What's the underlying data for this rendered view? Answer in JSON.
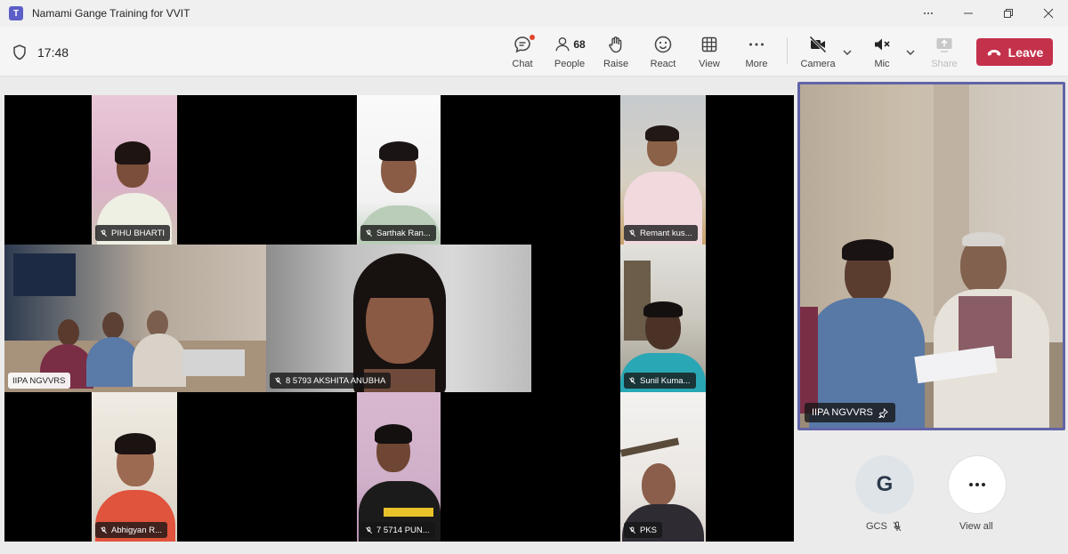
{
  "window": {
    "title": "Namami Gange Training for VVIT",
    "app_icon": "teams-icon"
  },
  "toolbar": {
    "timer": "17:48",
    "chat": "Chat",
    "people": "People",
    "people_count": "68",
    "raise": "Raise",
    "react": "React",
    "view": "View",
    "more": "More",
    "camera": "Camera",
    "mic": "Mic",
    "share": "Share",
    "leave": "Leave"
  },
  "grid": {
    "participants": [
      {
        "name": "PIHU BHARTI"
      },
      {
        "name": "Sarthak Ran..."
      },
      {
        "name": "Remant kus..."
      },
      {
        "name": "IIPA NGVVRS"
      },
      {
        "name": "8 5793 AKSHITA ANUBHA"
      },
      {
        "name": "Sunil  Kuma..."
      },
      {
        "name": "Abhigyan R..."
      },
      {
        "name": "7 5714 PUN..."
      },
      {
        "name": "PKS"
      }
    ]
  },
  "spotlight": {
    "name": "IIPA NGVVRS",
    "pinned": true
  },
  "bottom": {
    "gcs_initial": "G",
    "gcs_label": "GCS",
    "view_all": "View all"
  },
  "colors": {
    "accent": "#6264a7",
    "leave": "#c4314b",
    "notification": "#e3452b"
  }
}
